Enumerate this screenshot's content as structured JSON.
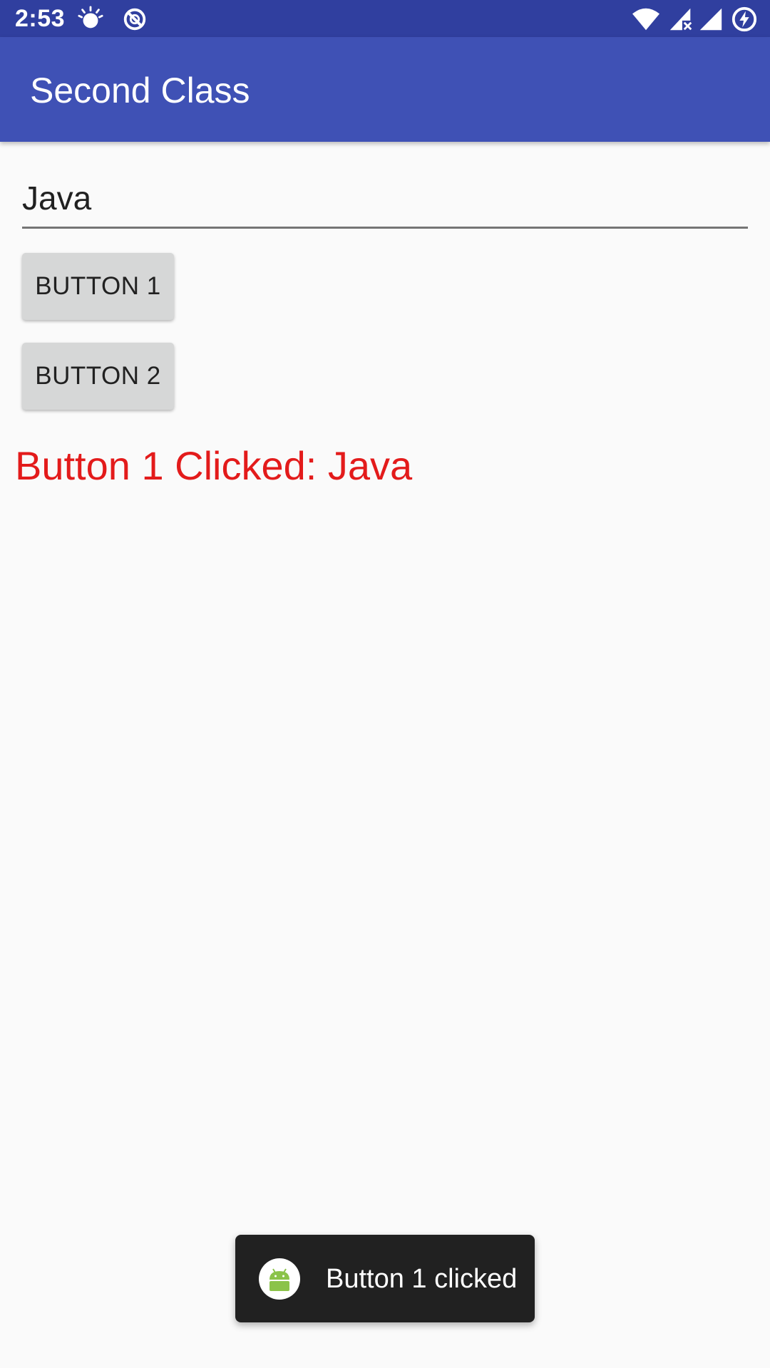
{
  "status_bar": {
    "time": "2:53",
    "icons": [
      "brightness-icon",
      "sync-disabled-icon",
      "wifi-icon",
      "signal-no-data-icon",
      "signal-icon",
      "battery-charging-icon"
    ],
    "background": "#303f9f"
  },
  "app_bar": {
    "title": "Second Class",
    "background": "#3f51b5"
  },
  "edit_text": {
    "value": "Java"
  },
  "buttons": {
    "button1_label": "BUTTON 1",
    "button2_label": "BUTTON 2"
  },
  "result": {
    "text": "Button 1 Clicked: Java",
    "color": "#e31b1b"
  },
  "toast": {
    "icon": "android-icon",
    "message": "Button 1 clicked"
  }
}
